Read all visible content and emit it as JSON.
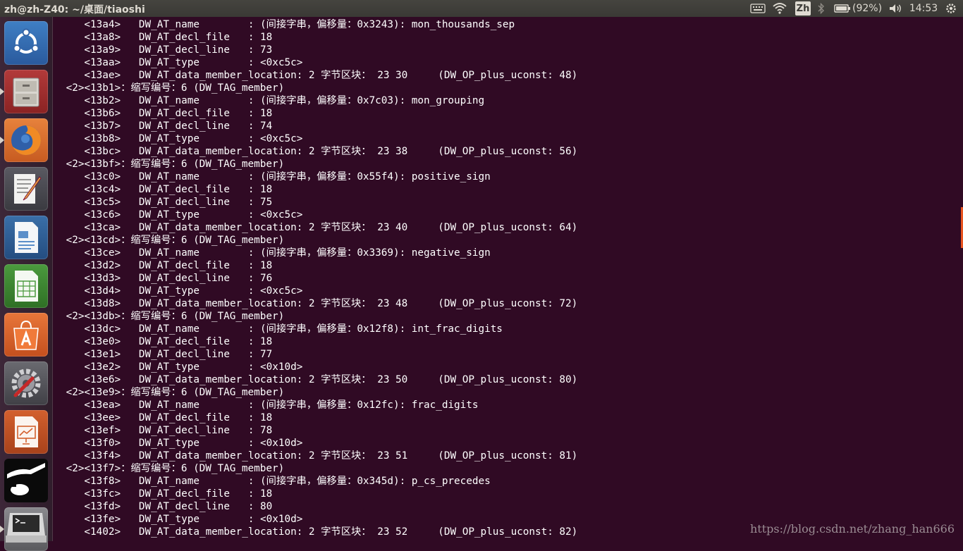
{
  "window": {
    "title": "zh@zh-Z40: ~/桌面/tiaoshi"
  },
  "top_panel": {
    "keyboard_icon": "keyboard-icon",
    "wifi_icon": "wifi-icon",
    "input_method": "Zh",
    "bluetooth_icon": "bluetooth-icon",
    "battery_text": "(92%)",
    "volume_icon": "volume-icon",
    "clock": "14:53",
    "power_icon": "gear-icon"
  },
  "launcher": {
    "items": [
      {
        "name": "Dash",
        "icon": "ubuntu-logo-icon",
        "running": false
      },
      {
        "name": "Files",
        "icon": "file-cabinet-icon",
        "running": true
      },
      {
        "name": "Firefox",
        "icon": "firefox-icon",
        "running": true
      },
      {
        "name": "Text Editor",
        "icon": "text-editor-icon",
        "running": false
      },
      {
        "name": "LibreOffice Writer",
        "icon": "writer-icon",
        "running": false
      },
      {
        "name": "LibreOffice Calc",
        "icon": "calc-icon",
        "running": false
      },
      {
        "name": "Ubuntu Software Center",
        "icon": "software-center-icon",
        "running": false
      },
      {
        "name": "System Settings",
        "icon": "settings-icon",
        "running": false
      },
      {
        "name": "LibreOffice Impress",
        "icon": "impress-icon",
        "running": false
      },
      {
        "name": "Image Viewer",
        "icon": "image-viewer-icon",
        "running": false
      },
      {
        "name": "Terminal",
        "icon": "terminal-icon",
        "running": true
      }
    ]
  },
  "terminal": {
    "lines": [
      "    <13a4>   DW_AT_name        : (间接字串，偏移量：0x3243): mon_thousands_sep",
      "    <13a8>   DW_AT_decl_file   : 18",
      "    <13a9>   DW_AT_decl_line   : 73",
      "    <13aa>   DW_AT_type        : <0xc5c>",
      "    <13ae>   DW_AT_data_member_location: 2 字节区块： 23 30     (DW_OP_plus_uconst: 48)",
      " <2><13b1>：缩写编号：6 (DW_TAG_member)",
      "    <13b2>   DW_AT_name        : (间接字串，偏移量：0x7c03): mon_grouping",
      "    <13b6>   DW_AT_decl_file   : 18",
      "    <13b7>   DW_AT_decl_line   : 74",
      "    <13b8>   DW_AT_type        : <0xc5c>",
      "    <13bc>   DW_AT_data_member_location: 2 字节区块： 23 38     (DW_OP_plus_uconst: 56)",
      " <2><13bf>：缩写编号：6 (DW_TAG_member)",
      "    <13c0>   DW_AT_name        : (间接字串，偏移量：0x55f4): positive_sign",
      "    <13c4>   DW_AT_decl_file   : 18",
      "    <13c5>   DW_AT_decl_line   : 75",
      "    <13c6>   DW_AT_type        : <0xc5c>",
      "    <13ca>   DW_AT_data_member_location: 2 字节区块： 23 40     (DW_OP_plus_uconst: 64)",
      " <2><13cd>：缩写编号：6 (DW_TAG_member)",
      "    <13ce>   DW_AT_name        : (间接字串，偏移量：0x3369): negative_sign",
      "    <13d2>   DW_AT_decl_file   : 18",
      "    <13d3>   DW_AT_decl_line   : 76",
      "    <13d4>   DW_AT_type        : <0xc5c>",
      "    <13d8>   DW_AT_data_member_location: 2 字节区块： 23 48     (DW_OP_plus_uconst: 72)",
      " <2><13db>：缩写编号：6 (DW_TAG_member)",
      "    <13dc>   DW_AT_name        : (间接字串，偏移量：0x12f8): int_frac_digits",
      "    <13e0>   DW_AT_decl_file   : 18",
      "    <13e1>   DW_AT_decl_line   : 77",
      "    <13e2>   DW_AT_type        : <0x10d>",
      "    <13e6>   DW_AT_data_member_location: 2 字节区块： 23 50     (DW_OP_plus_uconst: 80)",
      " <2><13e9>：缩写编号：6 (DW_TAG_member)",
      "    <13ea>   DW_AT_name        : (间接字串，偏移量：0x12fc): frac_digits",
      "    <13ee>   DW_AT_decl_file   : 18",
      "    <13ef>   DW_AT_decl_line   : 78",
      "    <13f0>   DW_AT_type        : <0x10d>",
      "    <13f4>   DW_AT_data_member_location: 2 字节区块： 23 51     (DW_OP_plus_uconst: 81)",
      " <2><13f7>：缩写编号：6 (DW_TAG_member)",
      "    <13f8>   DW_AT_name        : (间接字串，偏移量：0x345d): p_cs_precedes",
      "    <13fc>   DW_AT_decl_file   : 18",
      "    <13fd>   DW_AT_decl_line   : 80",
      "    <13fe>   DW_AT_type        : <0x10d>",
      "    <1402>   DW_AT_data_member_location: 2 字节区块： 23 52     (DW_OP_plus_uconst: 82)"
    ]
  },
  "watermark": "https://blog.csdn.net/zhang_han666",
  "colors": {
    "terminal_bg": "#300a24",
    "terminal_fg": "#ffffff",
    "panel_bg": "#3c3b37",
    "accent": "#e95420"
  }
}
